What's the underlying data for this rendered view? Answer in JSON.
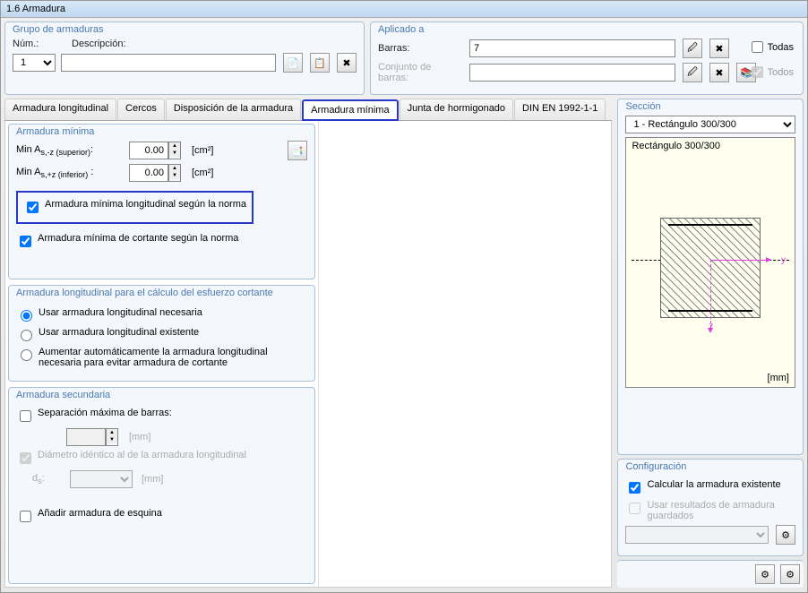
{
  "window_title": "1.6 Armadura",
  "grupo": {
    "title": "Grupo de armaduras",
    "num_label": "Núm.:",
    "num_value": "1",
    "desc_label": "Descripción:",
    "desc_value": ""
  },
  "aplicado": {
    "title": "Aplicado a",
    "barras_label": "Barras:",
    "barras_value": "7",
    "conjunto_label": "Conjunto de barras:",
    "todas_label": "Todas",
    "todos_label": "Todos"
  },
  "tabs": {
    "t1": "Armadura longitudinal",
    "t2": "Cercos",
    "t3": "Disposición de la armadura",
    "t4": "Armadura mínima",
    "t5": "Junta de hormigonado",
    "t6": "DIN EN 1992-1-1"
  },
  "armmin": {
    "title": "Armadura mínima",
    "minz_label_pre": "Min A",
    "minz_label_sub": "s,-z (superior)",
    "minz_label_post": ":",
    "minz_value": "0.00",
    "minpz_label_pre": "Min A",
    "minpz_label_sub": "s,+z (inferior)",
    "minpz_label_post": " :",
    "minpz_value": "0.00",
    "cm2": "[cm²]",
    "chk_long": "Armadura mínima longitudinal según la norma",
    "chk_cort": "Armadura mínima de cortante según la norma"
  },
  "armlong": {
    "title": "Armadura longitudinal para el cálculo del esfuerzo cortante",
    "r1": "Usar armadura longitudinal necesaria",
    "r2": "Usar armadura longitudinal existente",
    "r3": "Aumentar automáticamente la armadura longitudinal necesaria para evitar armadura de cortante"
  },
  "armsec": {
    "title": "Armadura secundaria",
    "sep": "Separación máxima de barras:",
    "mm": "[mm]",
    "diam": "Diámetro idéntico al de la armadura longitudinal",
    "ds_pre": "d",
    "ds_sub": "s",
    "ds_post": ":",
    "esq": "Añadir armadura de esquina"
  },
  "seccion": {
    "title": "Sección",
    "selected": "1 - Rectángulo 300/300",
    "caption": "Rectángulo 300/300",
    "unit": "[mm]",
    "y": "y",
    "z": "z"
  },
  "config": {
    "title": "Configuración",
    "calc": "Calcular la armadura existente",
    "usar": "Usar resultados de armadura guardados"
  }
}
